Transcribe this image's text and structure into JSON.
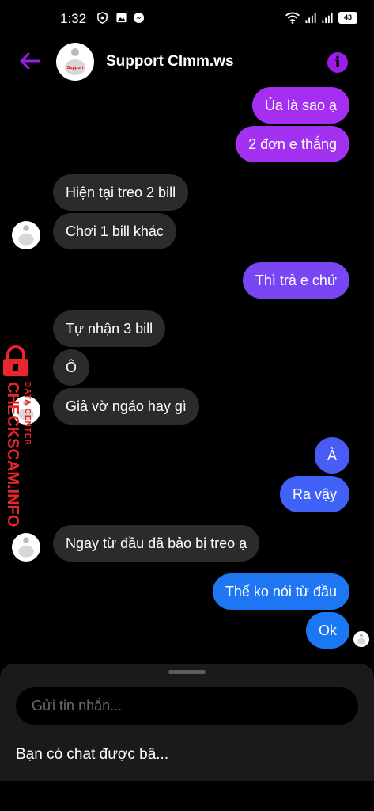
{
  "status_bar": {
    "time": "1:32",
    "battery": "43"
  },
  "header": {
    "contact_name": "Support Clmm.ws"
  },
  "messages": [
    {
      "text": "Ủa là sao ạ",
      "sender": "me"
    },
    {
      "text": "2 đơn e thắng",
      "sender": "me"
    },
    {
      "text": "Hiện tại treo 2 bill",
      "sender": "support"
    },
    {
      "text": "Chơi 1 bill khác",
      "sender": "support"
    },
    {
      "text": "Thì trả e chứ",
      "sender": "me"
    },
    {
      "text": "Tự nhận 3 bill",
      "sender": "support"
    },
    {
      "text": "Ô",
      "sender": "support"
    },
    {
      "text": "Giả vờ ngáo hay gì",
      "sender": "support"
    },
    {
      "text": "À",
      "sender": "me"
    },
    {
      "text": "Ra vậy",
      "sender": "me"
    },
    {
      "text": "Ngay từ đầu đã bảo bị treo ạ",
      "sender": "support"
    },
    {
      "text": "Thế ko nói từ đầu",
      "sender": "me"
    },
    {
      "text": "Ok",
      "sender": "me"
    }
  ],
  "composer": {
    "placeholder": "Gửi tin nhắn..."
  },
  "suggestion": "Bạn có chat được bâ...",
  "watermark": {
    "brand": "CHECKSCAM.INFO",
    "tagline": "DATA CENTER"
  },
  "avatar_label": "Support",
  "colors": {
    "accent": "#9b1ee6",
    "bubble_gradient": [
      "#a42ff0",
      "#8b3cf2",
      "#6a4ef5",
      "#3e63f7",
      "#1a78f2"
    ],
    "incoming_bubble": "#2b2b2d",
    "watermark": "#e8262b"
  }
}
